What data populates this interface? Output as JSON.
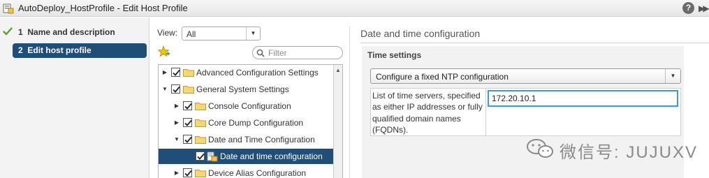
{
  "window": {
    "title": "AutoDeploy_HostProfile - Edit Host Profile",
    "help_label": "?",
    "expand_label": "▶▶"
  },
  "steps": [
    {
      "number": "1",
      "label": "Name and description",
      "status": "completed"
    },
    {
      "number": "2",
      "label": "Edit host profile",
      "status": "active"
    }
  ],
  "tree_panel": {
    "view_label": "View:",
    "view_value": "All",
    "filter_placeholder": "Filter",
    "items": [
      {
        "label": "Advanced Configuration Settings",
        "expanded": false,
        "checked": true
      },
      {
        "label": "General System Settings",
        "expanded": true,
        "checked": true
      },
      {
        "label": "Console Configuration",
        "expanded": false,
        "checked": true
      },
      {
        "label": "Core Dump Configuration",
        "expanded": false,
        "checked": true
      },
      {
        "label": "Date and Time Configuration",
        "expanded": true,
        "checked": true
      },
      {
        "label": "Date and time configuration",
        "selected": true,
        "checked": true
      },
      {
        "label": "Device Alias Configuration",
        "expanded": false,
        "checked": true
      }
    ]
  },
  "detail": {
    "section_title": "Date and time configuration",
    "group_title": "Time settings",
    "ntp_mode": "Configure a fixed NTP configuration",
    "servers_label": "List of time servers, specified as either IP addresses or fully qualified domain names (FQDNs).",
    "servers_value": "172.20.10.1"
  },
  "watermark": {
    "text": "微信号: JUJUXV"
  },
  "colors": {
    "selection": "#1f4e79",
    "focus_border": "#3a9bd8",
    "check_green": "#5aa02c",
    "folder_yellow": "#f2c14e"
  }
}
